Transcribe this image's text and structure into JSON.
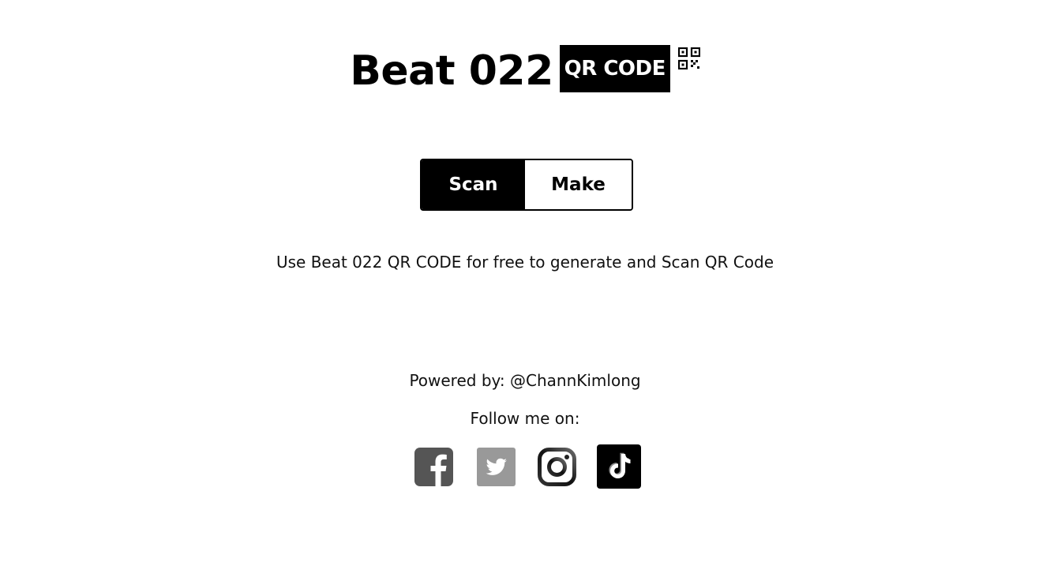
{
  "header": {
    "title": "Beat 022",
    "badge": "QR CODE",
    "qr_icon": "qr-code-icon"
  },
  "mode_toggle": {
    "scan_label": "Scan",
    "make_label": "Make",
    "selected": "Scan"
  },
  "tagline": "Use Beat 022 QR CODE for free to generate and Scan QR Code",
  "footer": {
    "powered_by": "Powered by: @ChannKimlong",
    "follow_label": "Follow me on:",
    "socials": [
      {
        "name": "facebook",
        "icon": "facebook-icon",
        "color": "#555555"
      },
      {
        "name": "twitter",
        "icon": "twitter-icon",
        "color": "#999999"
      },
      {
        "name": "instagram",
        "icon": "instagram-icon",
        "color": "#222222"
      },
      {
        "name": "tiktok",
        "icon": "tiktok-icon",
        "color": "#000000"
      }
    ]
  },
  "colors": {
    "background": "#ffffff",
    "primary": "#000000",
    "text": "#111111"
  }
}
